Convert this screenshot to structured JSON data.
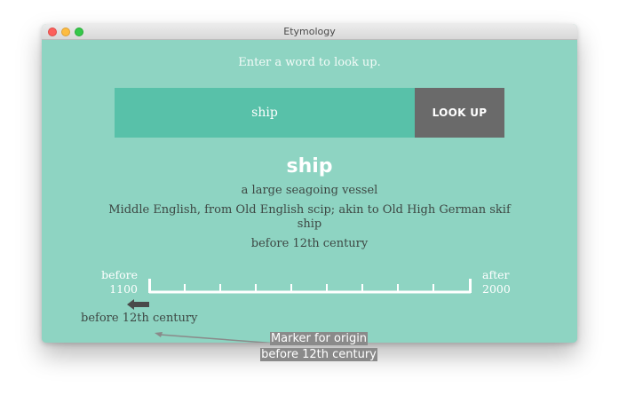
{
  "window": {
    "title": "Etymology"
  },
  "search": {
    "prompt": "Enter a word to look up.",
    "value": "ship",
    "button_label": "LOOK UP"
  },
  "result": {
    "word": "ship",
    "definition": "a large seagoing vessel",
    "etymology_line1": "Middle English, from Old English scip; akin to Old High German skif",
    "etymology_line2": "ship",
    "first_known_use": "before 12th century"
  },
  "timeline": {
    "start_label_top": "before",
    "start_label_bottom": "1100",
    "end_label_top": "after",
    "end_label_bottom": "2000",
    "marker_label": "before 12th century"
  },
  "tooltip": {
    "line1": "Marker for origin",
    "line2": "before 12th century"
  },
  "colors": {
    "background": "#8ed4c2",
    "input": "#58c1a9",
    "button": "#6a6a6a"
  }
}
